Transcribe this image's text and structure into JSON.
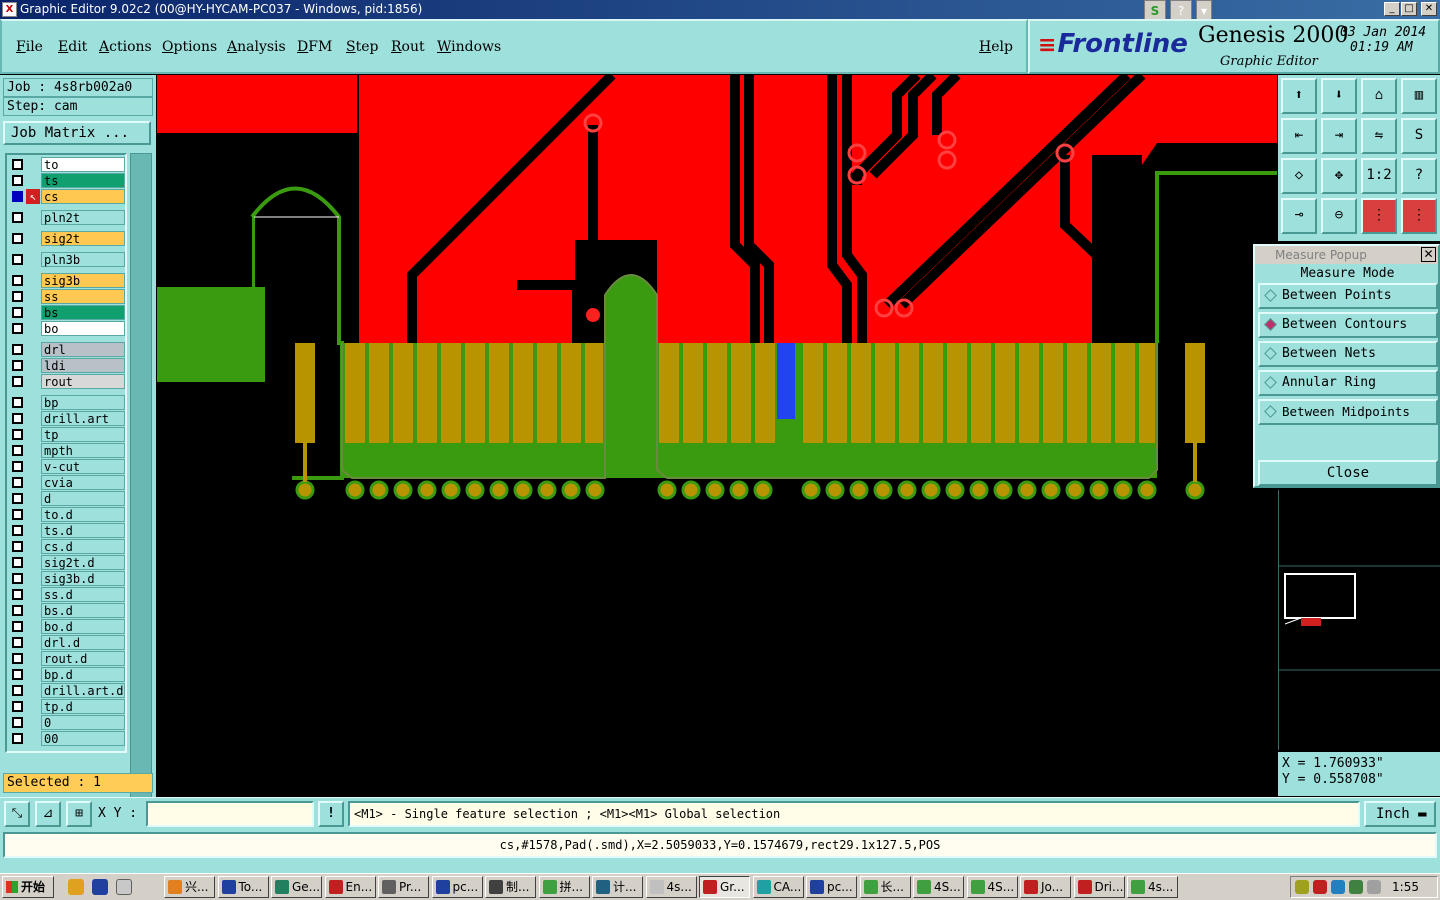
{
  "window": {
    "title": "Graphic Editor 9.02c2 (00@HY-HYCAM-PC037 - Windows, pid:1856)",
    "minimize": "_",
    "maximize": "□",
    "close": "✕",
    "mini_tools": [
      "S",
      "?",
      "▾"
    ]
  },
  "menu": {
    "items": [
      "File",
      "Edit",
      "Actions",
      "Options",
      "Analysis",
      "DFM",
      "Step",
      "Rout",
      "Windows"
    ],
    "help": "Help"
  },
  "brand": {
    "logo": "Frontline",
    "product": "Genesis 2000",
    "subtitle": "Graphic Editor",
    "date": "03 Jan 2014",
    "time": "01:19 AM"
  },
  "job": {
    "job_line": "Job : 4s8rb002a0",
    "step_line": "Step: cam",
    "matrix_button": "Job Matrix ...",
    "selected": "Selected : 1"
  },
  "layers": [
    {
      "name": "to",
      "color": "#ffffff"
    },
    {
      "name": "ts",
      "color": "#10a070"
    },
    {
      "name": "cs",
      "color": "#ffc850",
      "active": true
    },
    {
      "name": "pln2t",
      "color": "#9ee0dc"
    },
    {
      "name": "sig2t",
      "color": "#ffc850"
    },
    {
      "name": "pln3b",
      "color": "#9ee0dc"
    },
    {
      "name": "sig3b",
      "color": "#ffc850"
    },
    {
      "name": "ss",
      "color": "#ffc850"
    },
    {
      "name": "bs",
      "color": "#10a070"
    },
    {
      "name": "bo",
      "color": "#ffffff"
    },
    {
      "name": "drl",
      "color": "#b8c0c8"
    },
    {
      "name": "ldi",
      "color": "#b8c0c8"
    },
    {
      "name": "rout",
      "color": "#d8d8d8"
    },
    {
      "name": "bp",
      "color": "#9ee0dc"
    },
    {
      "name": "drill.art",
      "color": "#9ee0dc"
    },
    {
      "name": "tp",
      "color": "#9ee0dc"
    },
    {
      "name": "mpth",
      "color": "#9ee0dc"
    },
    {
      "name": "v-cut",
      "color": "#9ee0dc"
    },
    {
      "name": "cvia",
      "color": "#9ee0dc"
    },
    {
      "name": "d",
      "color": "#9ee0dc"
    },
    {
      "name": "to.d",
      "color": "#9ee0dc"
    },
    {
      "name": "ts.d",
      "color": "#9ee0dc"
    },
    {
      "name": "cs.d",
      "color": "#9ee0dc"
    },
    {
      "name": "sig2t.d",
      "color": "#9ee0dc"
    },
    {
      "name": "sig3b.d",
      "color": "#9ee0dc"
    },
    {
      "name": "ss.d",
      "color": "#9ee0dc"
    },
    {
      "name": "bs.d",
      "color": "#9ee0dc"
    },
    {
      "name": "bo.d",
      "color": "#9ee0dc"
    },
    {
      "name": "drl.d",
      "color": "#9ee0dc"
    },
    {
      "name": "rout.d",
      "color": "#9ee0dc"
    },
    {
      "name": "bp.d",
      "color": "#9ee0dc"
    },
    {
      "name": "drill.art.d",
      "color": "#9ee0dc"
    },
    {
      "name": "tp.d",
      "color": "#9ee0dc"
    },
    {
      "name": "0",
      "color": "#9ee0dc"
    },
    {
      "name": "00",
      "color": "#9ee0dc"
    }
  ],
  "tools": {
    "icons": [
      "zoom-home-icon",
      "zoom-back-icon",
      "home-icon",
      "split-view-icon",
      "pan-left-icon",
      "pan-right-icon",
      "mirror-icon",
      "snap-icon",
      "fit-icon",
      "center-icon",
      "scale-icon",
      "help-query-icon",
      "measure-tool-icon",
      "probe-icon",
      "layers-red-icon",
      "layers-red-alt-icon"
    ],
    "scale_label": "1:2",
    "query_label": "?"
  },
  "measure_popup": {
    "title": "Measure Popup",
    "heading": "Measure Mode",
    "options": [
      "Between Points",
      "Between Contours",
      "Between Nets",
      "Annular Ring",
      "Between Midpoints"
    ],
    "selected_index": 1,
    "close": "Close"
  },
  "coordinates": {
    "x": "X = 1.760933\"",
    "y": "Y = 0.558708\""
  },
  "command": {
    "xy_label": "X Y :",
    "xy_value": "",
    "alert": "!",
    "message": "<M1> - Single feature selection ; <M1><M1> Global selection",
    "unit": "Inch"
  },
  "status": "cs,#1578,Pad(.smd),X=2.5059033,Y=0.1574679,rect29.1x127.5,POS",
  "taskbar": {
    "start": "开始",
    "tasks": [
      "兴...",
      "To...",
      "Ge...",
      "En...",
      "Pr...",
      "pc...",
      "制...",
      "拼...",
      "计...",
      "4s...",
      "Gr...",
      "CA...",
      "pc...",
      "长...",
      "4S...",
      "4S...",
      "Jo...",
      "Dri...",
      "4s..."
    ],
    "active_index": 10,
    "clock": "1:55"
  },
  "colors": {
    "panel": "#9ee0dc",
    "copper_plane": "#ff0000",
    "pad_gold": "#b89400",
    "solder_green": "#3a9a10",
    "highlight_blue": "#2244ee"
  }
}
